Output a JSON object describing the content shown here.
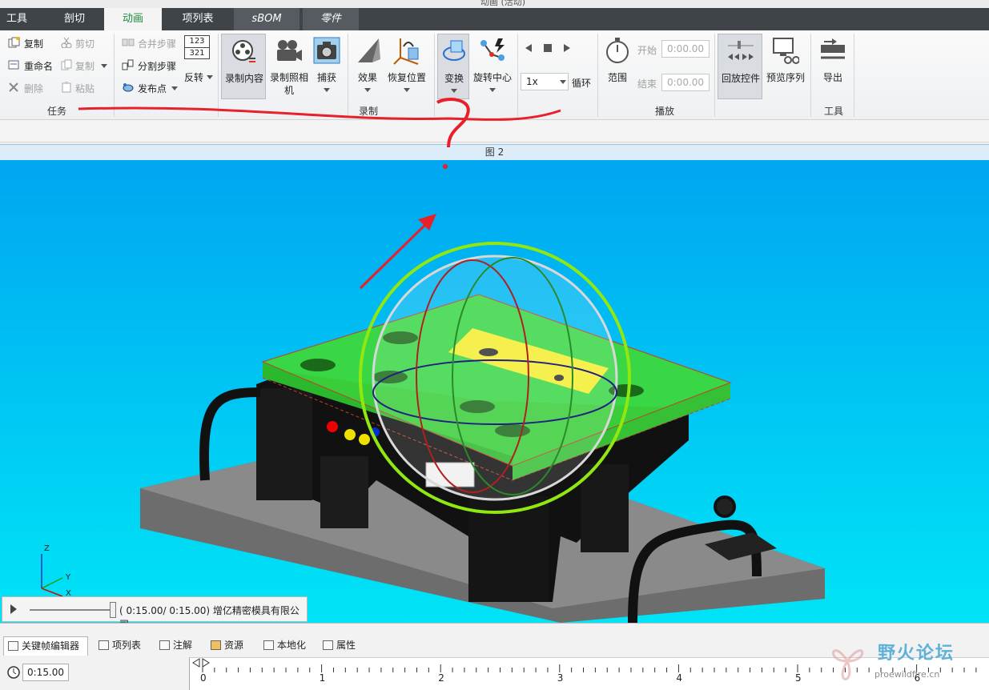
{
  "window": {
    "title": "动画 (活动)"
  },
  "tabs": [
    {
      "label": "工具"
    },
    {
      "label": "剖切"
    },
    {
      "label": "动画"
    },
    {
      "label": "项列表"
    },
    {
      "label": "sBOM"
    },
    {
      "label": "零件"
    }
  ],
  "ribbon": {
    "task": {
      "label": "任务",
      "copy": "复制",
      "cut": "剪切",
      "rename": "重命名",
      "copy2": "复制",
      "delete": "删除",
      "paste": "粘贴",
      "merge_steps": "合并步骤",
      "split_steps": "分割步骤",
      "publish_point": "发布点",
      "reverse": "反转",
      "reverse_nums_top": "123",
      "reverse_nums_bottom": "321"
    },
    "record": {
      "label": "录制",
      "record_content": "录制内容",
      "record_camera_line1": "录制照相",
      "record_camera_line2": "机",
      "capture": "捕获",
      "effect": "效果",
      "restore_position": "恢复位置",
      "transform": "变换",
      "rotate_center": "旋转中心"
    },
    "playback": {
      "label": "播放",
      "speed": "1x",
      "loop": "循环",
      "range": "范围",
      "start_label": "开始",
      "start_value": "0:00.00",
      "end_label": "结束",
      "end_value": "0:00.00",
      "playback_controls": "回放控件",
      "preview_sequence": "预览序列"
    },
    "tools": {
      "label": "工具",
      "export": "导出"
    }
  },
  "viewport": {
    "header": "图 2",
    "axis_labels": {
      "z": "Z",
      "y": "Y",
      "x": "X"
    },
    "playbar_text": "( 0:15.00/ 0:15.00) 增亿精密模具有限公司"
  },
  "bottom": {
    "tabs": [
      {
        "label": "关键帧编辑器"
      },
      {
        "label": "项列表"
      },
      {
        "label": "注解"
      },
      {
        "label": "资源"
      },
      {
        "label": "本地化"
      },
      {
        "label": "属性"
      }
    ],
    "time_value": "0:15.00",
    "timeline_ticks": [
      "0",
      "1",
      "2",
      "3",
      "4",
      "5",
      "6"
    ]
  },
  "watermark": {
    "name": "野火论坛",
    "url": "proewildfire.cn"
  },
  "colors": {
    "tab_bar": "#3f4448",
    "active_tab_text": "#1a8a3a",
    "viewport_top": "#00a6f0",
    "viewport_bottom": "#00e4f6",
    "annotation_red": "#e8202a"
  }
}
